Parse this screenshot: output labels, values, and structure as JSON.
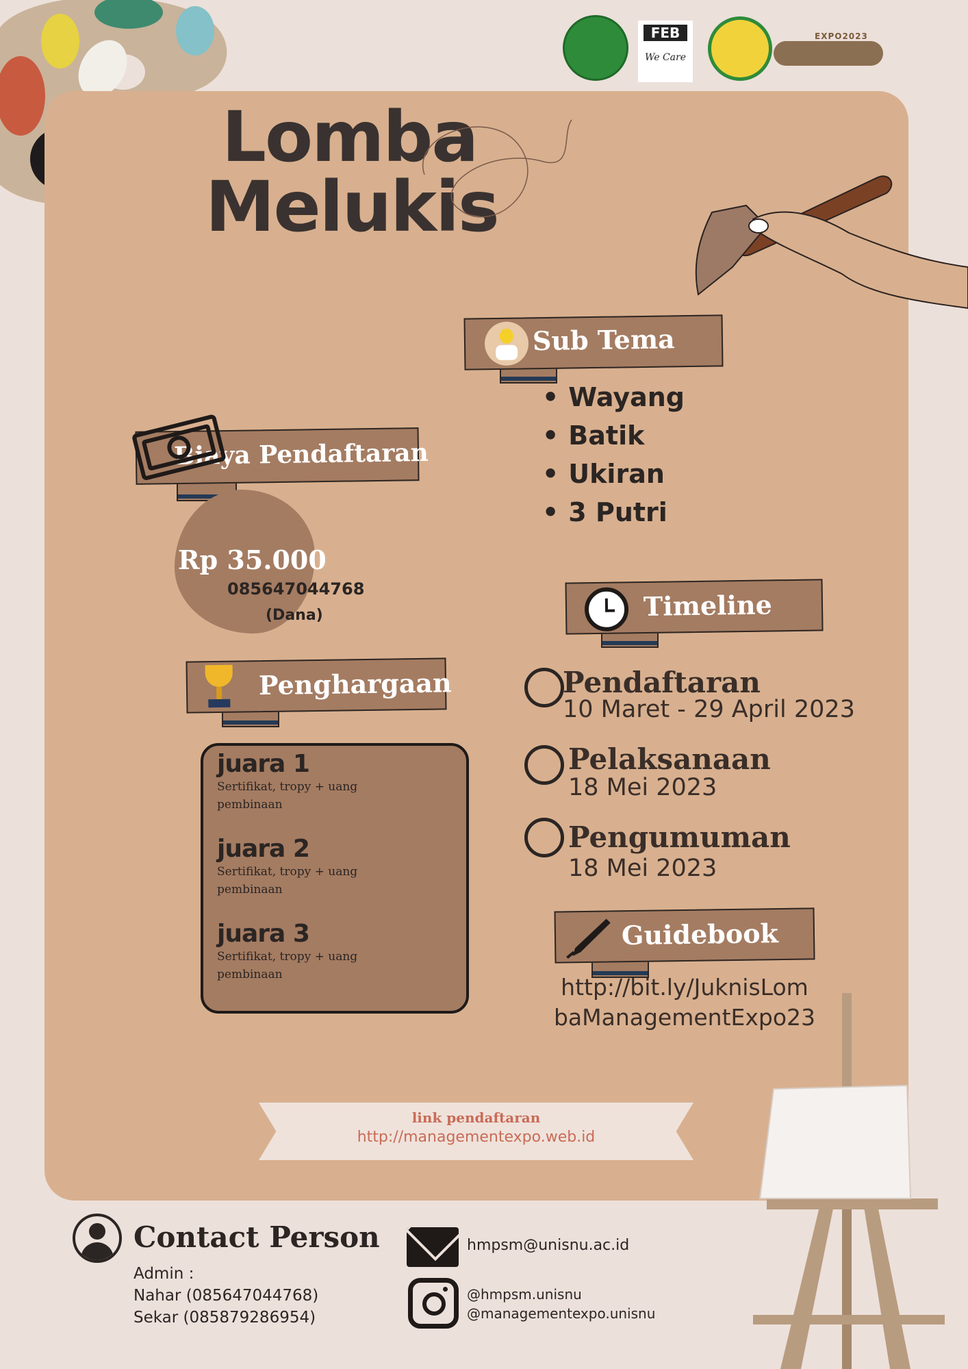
{
  "header": {
    "logos": [
      {
        "name": "unisnu-seal-logo",
        "color": "#2e8b3a"
      },
      {
        "name": "feb-logo",
        "text": "FEB",
        "subtext": "We Care"
      },
      {
        "name": "hmpsm-logo",
        "color": "#2e8b3a"
      },
      {
        "name": "management-expo-logo",
        "text": "EXPO2023"
      }
    ]
  },
  "title": {
    "line1": "Lomba",
    "line2": "Melukis"
  },
  "sub_tema": {
    "label": "Sub Tema",
    "items": [
      "Wayang",
      "Batik",
      "Ukiran",
      "3 Putri"
    ]
  },
  "biaya": {
    "label": "Biaya Pendaftaran",
    "price": "Rp 35.000",
    "phone": "085647044768",
    "method": "(Dana)"
  },
  "timeline": {
    "label": "Timeline",
    "items": [
      {
        "title": "Pendaftaran",
        "date": "10 Maret - 29 April 2023"
      },
      {
        "title": "Pelaksanaan",
        "date": "18 Mei 2023"
      },
      {
        "title": "Pengumuman",
        "date": "18 Mei 2023"
      }
    ]
  },
  "penghargaan": {
    "label": "Penghargaan",
    "items": [
      {
        "rank": "juara 1",
        "desc_line1": "Sertifikat, tropy + uang",
        "desc_line2": "pembinaan"
      },
      {
        "rank": "juara 2",
        "desc_line1": "Sertifikat, tropy + uang",
        "desc_line2": "pembinaan"
      },
      {
        "rank": "juara 3",
        "desc_line1": "Sertifikat, tropy + uang",
        "desc_line2": "pembinaan"
      }
    ]
  },
  "guidebook": {
    "label": "Guidebook",
    "link_line1": "http://bit.ly/JuknisLom",
    "link_line2": "baManagementExpo23"
  },
  "registration": {
    "label": "link pendaftaran",
    "url": "http://managementexpo.web.id"
  },
  "contact": {
    "heading": "Contact Person",
    "admin_label": "Admin :",
    "admins": [
      "Nahar (085647044768)",
      "Sekar (085879286954)"
    ],
    "email": "hmpsm@unisnu.ac.id",
    "instagram": [
      "@hmpsm.unisnu",
      "@managementexpo.unisnu"
    ]
  },
  "colors": {
    "background": "#ece0da",
    "panel": "#d8b08f",
    "ribbon": "#a47c62",
    "link": "#c96b56"
  }
}
